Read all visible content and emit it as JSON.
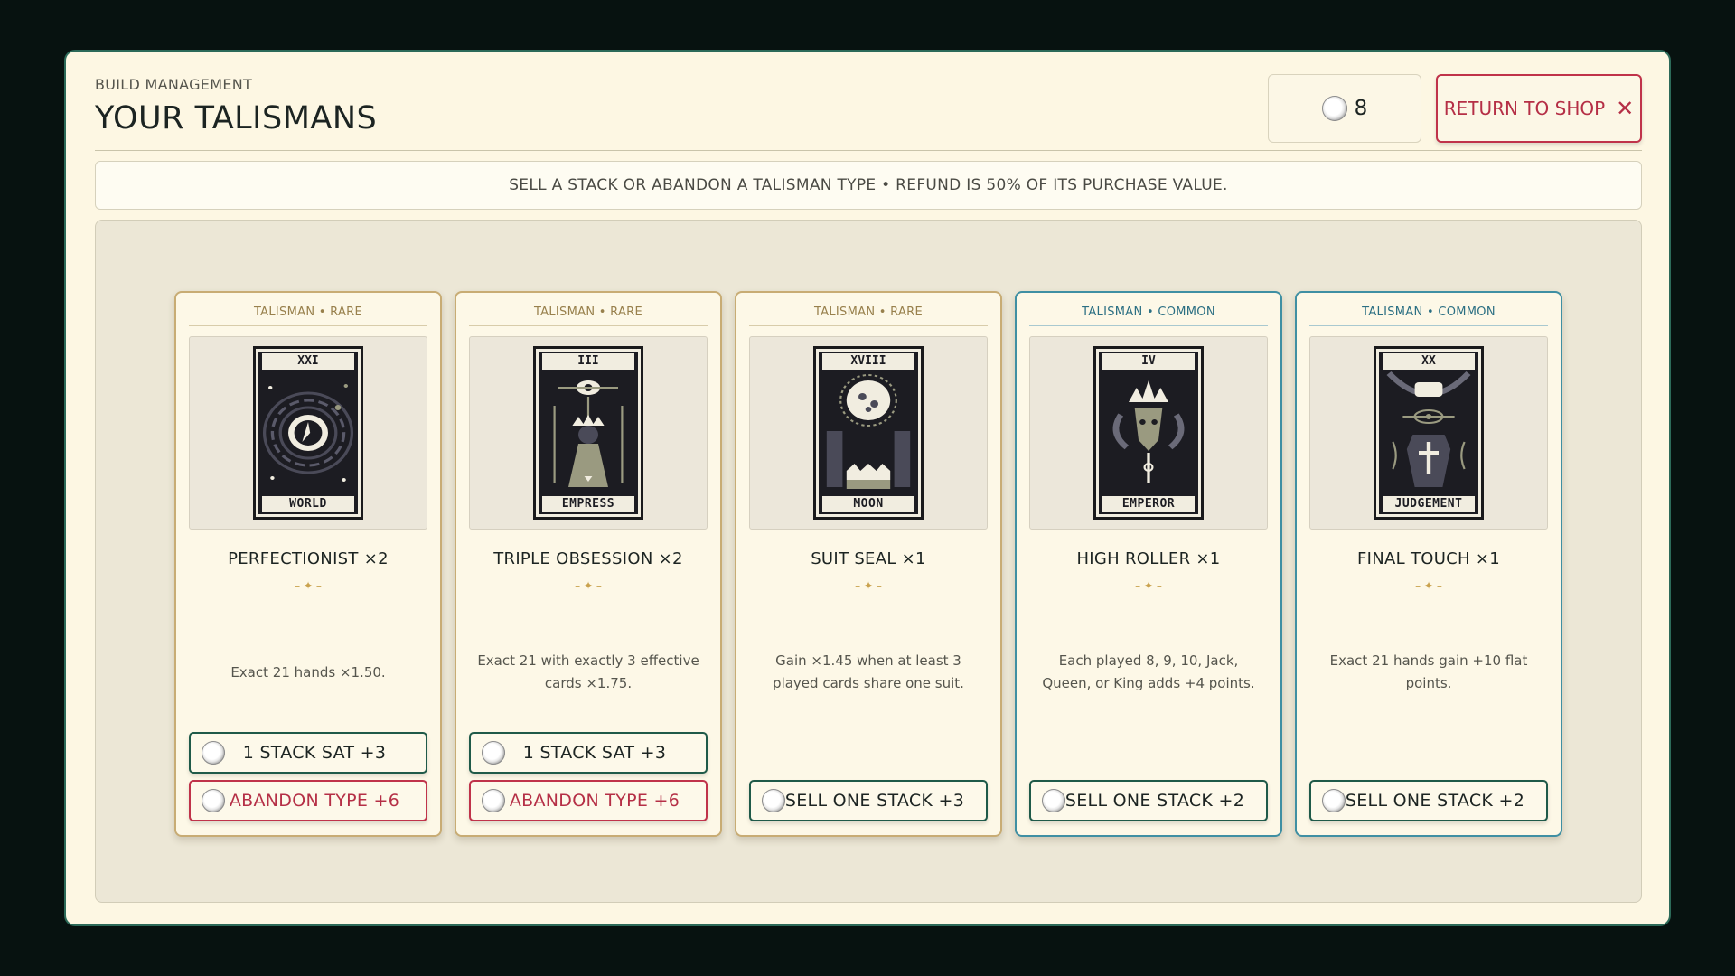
{
  "header": {
    "subtitle": "BUILD MANAGEMENT",
    "title": "YOUR TALISMANS",
    "coins": "8",
    "return_label": "RETURN TO SHOP",
    "close_glyph": "✕"
  },
  "notice": "SELL A STACK OR ABANDON A TALISMAN TYPE • REFUND IS 50% OF ITS PURCHASE VALUE.",
  "divider": "– ✦ –",
  "cards": [
    {
      "tag": "TALISMAN • RARE",
      "numeral": "XXI",
      "arcana": "WORLD",
      "title": "PERFECTIONIST  ×2",
      "desc": "Exact 21 hands ×1.50.",
      "btn1": "1 STACK SAT  +3",
      "btn2": "ABANDON TYPE  +6"
    },
    {
      "tag": "TALISMAN • RARE",
      "numeral": "III",
      "arcana": "EMPRESS",
      "title": "TRIPLE OBSESSION  ×2",
      "desc": "Exact 21 with exactly 3 effective cards ×1.75.",
      "btn1": "1 STACK SAT  +3",
      "btn2": "ABANDON TYPE  +6"
    },
    {
      "tag": "TALISMAN • RARE",
      "numeral": "XVIII",
      "arcana": "MOON",
      "title": "SUIT SEAL  ×1",
      "desc": "Gain ×1.45 when at least 3 played cards share one suit.",
      "btn1": "SELL ONE STACK  +3"
    },
    {
      "tag": "TALISMAN • COMMON",
      "numeral": "IV",
      "arcana": "EMPEROR",
      "title": "HIGH ROLLER  ×1",
      "desc": "Each played 8, 9, 10, Jack, Queen, or King adds +4 points.",
      "btn1": "SELL ONE STACK  +2"
    },
    {
      "tag": "TALISMAN • COMMON",
      "numeral": "XX",
      "arcana": "JUDGEMENT",
      "title": "FINAL TOUCH  ×1",
      "desc": "Exact 21 hands gain +10 flat points.",
      "btn1": "SELL ONE STACK  +2"
    }
  ],
  "colors": {
    "panel_bg": "#fdf7e3",
    "panel_border": "#2c6a59",
    "rare_border": "#c8ac74",
    "common_border": "#3f8fa3",
    "danger": "#c0334a",
    "sell_border": "#1f5a49"
  },
  "icons": {
    "coin": "silver-coin-icon",
    "close": "close-icon"
  }
}
